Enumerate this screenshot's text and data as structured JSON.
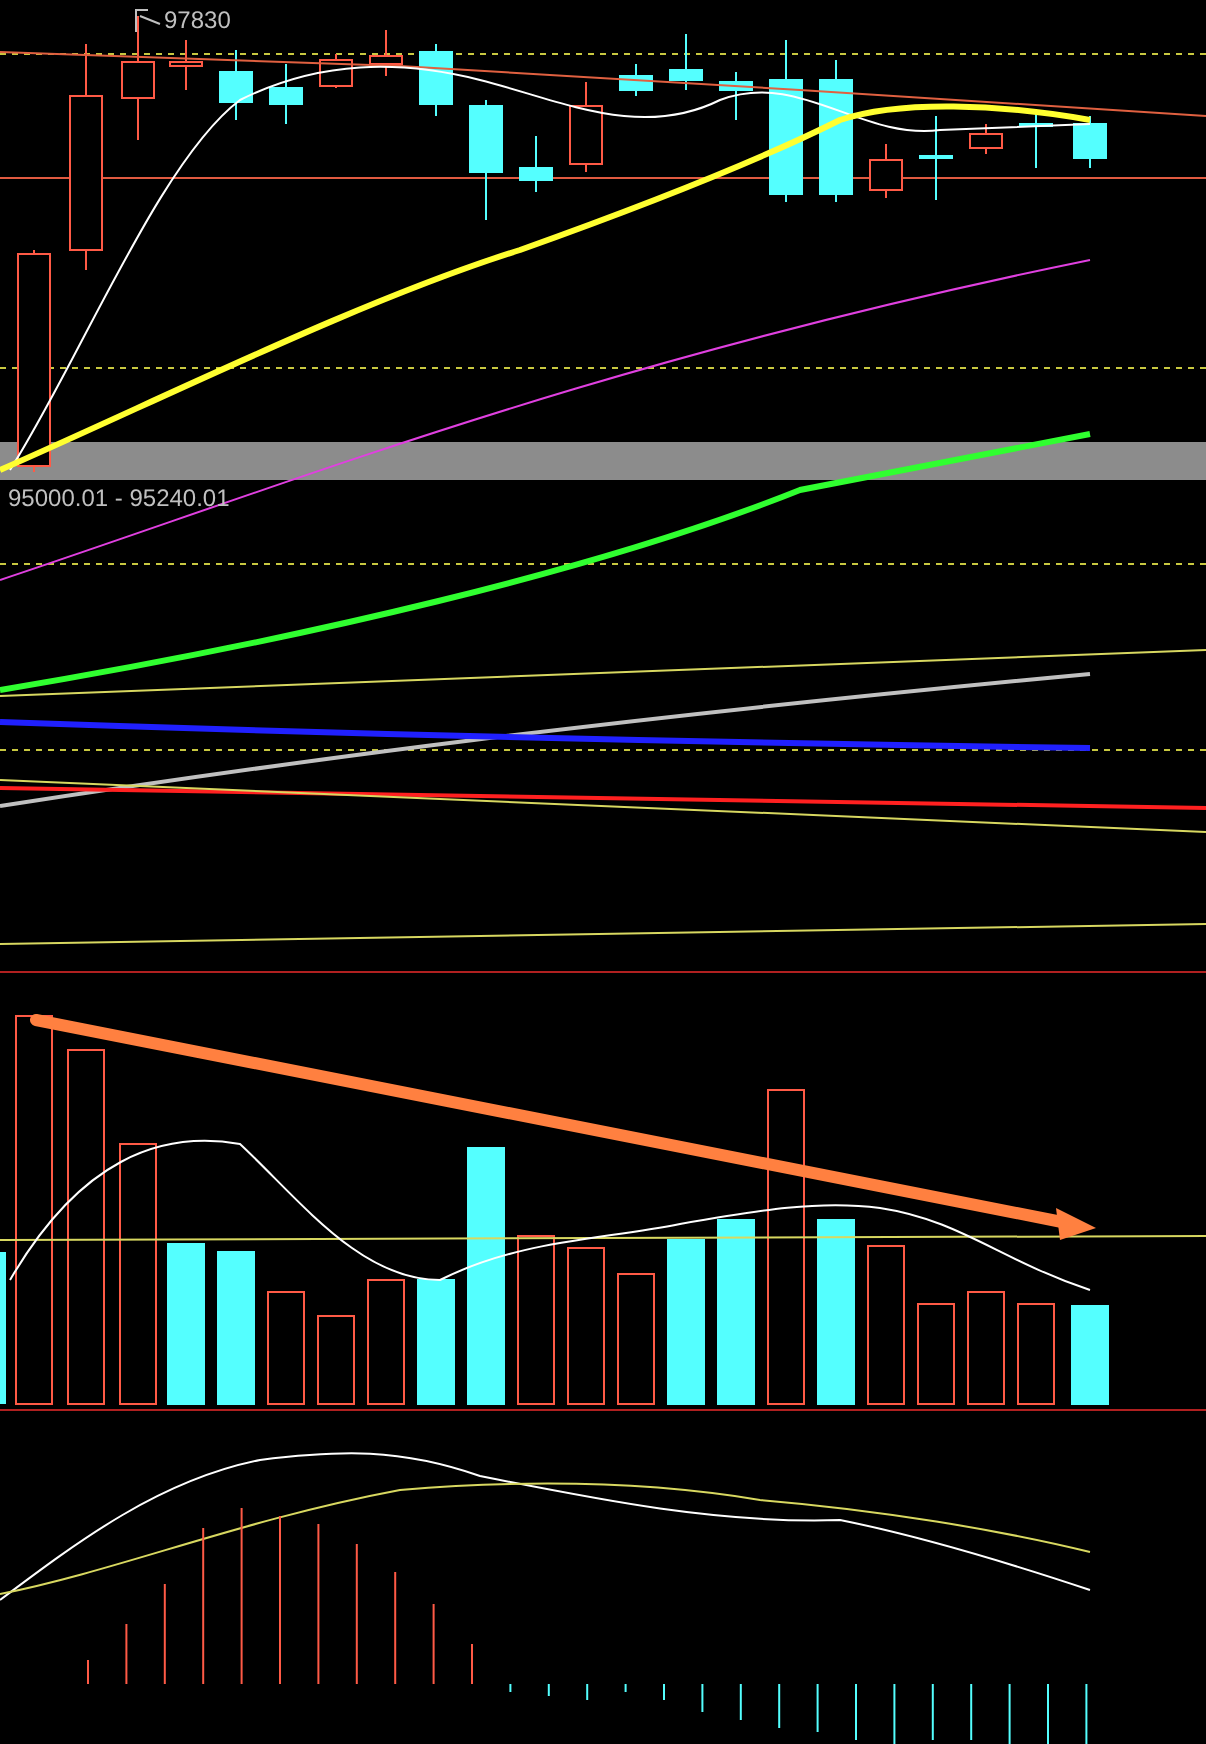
{
  "price_chart": {
    "high_label": "97830",
    "range_label": "95000.01 - 95240.01"
  }
}
